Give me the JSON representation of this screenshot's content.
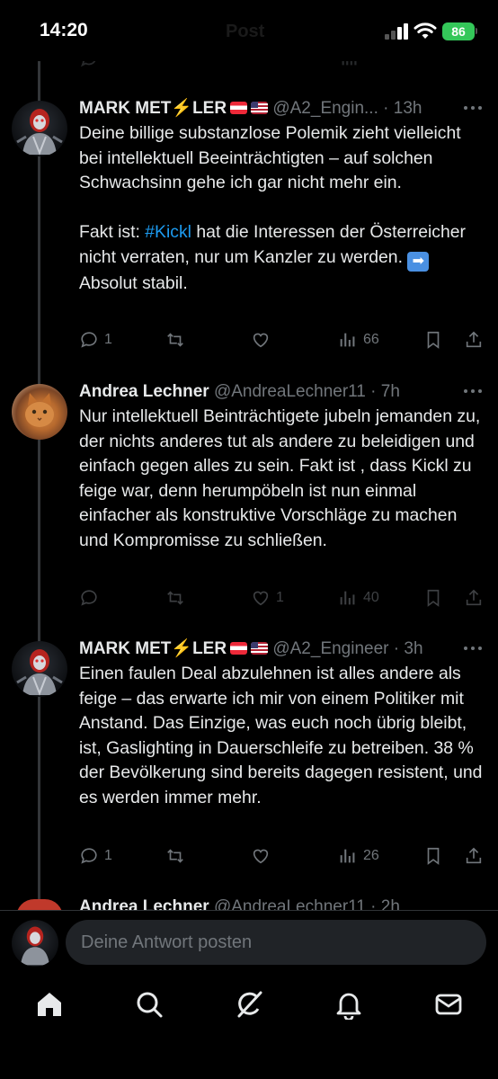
{
  "status_bar": {
    "time": "14:20",
    "battery": "86",
    "ghost_title": "Post"
  },
  "tweets": [
    {
      "name": "MARK MET",
      "name_suffix": "LER",
      "handle": "@A2_Engin...",
      "time": "13h",
      "text_before_tag": "Deine billige substanzlose Polemik zieht vielleicht bei intellektuell Beeinträchtigten – auf solchen Schwachsinn gehe ich gar nicht mehr ein.\n\nFakt ist: ",
      "hashtag": "#Kickl",
      "text_after_tag": " hat die Interessen der Österreicher nicht verraten, nur um Kanzler zu werden. ",
      "text_tail": " Absolut stabil.",
      "replies": "1",
      "retweets": "",
      "likes": "",
      "views": "66"
    },
    {
      "name": "Andrea Lechner",
      "handle": "@AndreaLechner11",
      "time": "7h",
      "text": "Nur intellektuell Beinträchtigete jubeln jemanden zu, der nichts anderes tut als andere zu beleidigen und einfach gegen alles zu sein. Fakt ist , dass Kickl zu feige war, denn herumpöbeln ist nun einmal einfacher als konstruktive Vorschläge zu machen und Kompromisse zu schließen.",
      "replies": "",
      "retweets": "",
      "likes": "1",
      "views": "40"
    },
    {
      "name": "MARK MET",
      "name_suffix": "LER",
      "handle": "@A2_Engineer",
      "time": "3h",
      "text": "Einen faulen Deal abzulehnen ist alles andere als feige – das erwarte ich mir von einem Politiker mit Anstand. Das Einzige, was euch noch übrig bleibt, ist, Gaslighting in Dauerschleife zu betreiben. 38 % der Bevölkerung sind bereits dagegen resistent, und es werden immer mehr.",
      "replies": "1",
      "retweets": "",
      "likes": "",
      "views": "26"
    }
  ],
  "partial_tweet": {
    "name": "Andrea Lechner",
    "handle": "@AndreaLechner11",
    "time": "2h"
  },
  "composer": {
    "placeholder": "Deine Antwort posten"
  },
  "nav": [
    "home-icon",
    "search-icon",
    "grok-icon",
    "bell-icon",
    "mail-icon"
  ],
  "colors": {
    "background": "#000000",
    "text": "#e7e9ea",
    "muted": "#71767b",
    "accent": "#1d9bf0",
    "battery": "#34c759"
  }
}
